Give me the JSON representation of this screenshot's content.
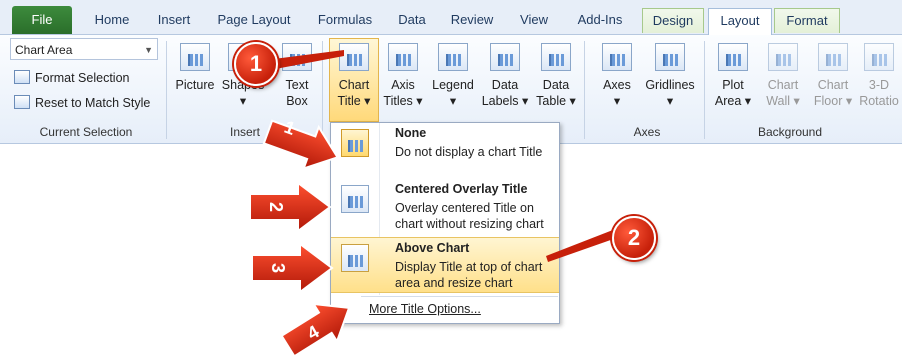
{
  "tabs": [
    "File",
    "Home",
    "Insert",
    "Page Layout",
    "Formulas",
    "Data",
    "Review",
    "View",
    "Add-Ins",
    "Design",
    "Layout",
    "Format"
  ],
  "current_selection": {
    "combo_value": "Chart Area",
    "format_selection": "Format Selection",
    "reset": "Reset to Match Style",
    "group_label": "Current Selection"
  },
  "insert_group": {
    "picture": "Picture",
    "shapes": "Shapes",
    "text_box_1": "Text",
    "text_box_2": "Box",
    "label": "Insert"
  },
  "labels_group": {
    "chart_title_1": "Chart",
    "chart_title_2": "Title",
    "axis_titles_1": "Axis",
    "axis_titles_2": "Titles",
    "legend": "Legend",
    "data_labels_1": "Data",
    "data_labels_2": "Labels",
    "data_table_1": "Data",
    "data_table_2": "Table"
  },
  "axes_group": {
    "axes": "Axes",
    "gridlines": "Gridlines",
    "label": "Axes"
  },
  "background_group": {
    "plot_area_1": "Plot",
    "plot_area_2": "Area",
    "chart_wall_1": "Chart",
    "chart_wall_2": "Wall",
    "chart_floor_1": "Chart",
    "chart_floor_2": "Floor",
    "rotation_1": "3-D",
    "rotation_2": "Rotatio",
    "label": "Background"
  },
  "menu": {
    "none_title": "None",
    "none_desc": "Do not display a chart Title",
    "overlay_title": "Centered Overlay Title",
    "overlay_desc": "Overlay centered Title on chart without resizing chart",
    "above_title": "Above Chart",
    "above_desc": "Display Title at top of chart area and resize chart",
    "more": "More Title Options..."
  },
  "callouts": {
    "c1": "1",
    "c2": "2",
    "a1": "1",
    "a2": "2",
    "a3": "3",
    "a4": "4"
  },
  "colors": {
    "callout": "#d42a10",
    "highlight": "#ffe08a",
    "file_tab": "#2f7a2f"
  }
}
